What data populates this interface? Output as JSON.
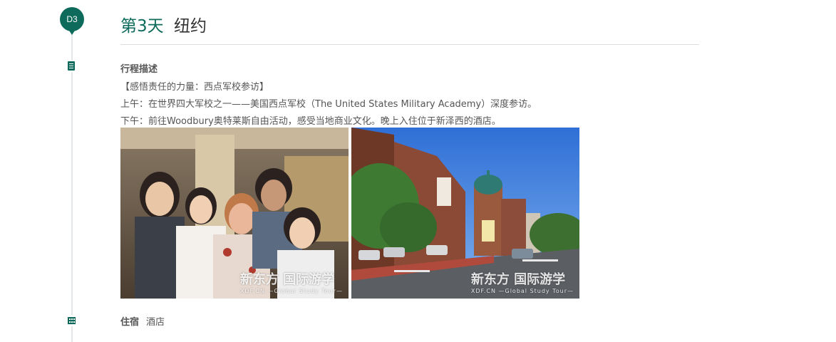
{
  "day": {
    "badge": "D3",
    "label": "第3天",
    "city": "纽约"
  },
  "itinerary": {
    "section_title": "行程描述",
    "lines": [
      "【感悟责任的力量：西点军校参访】",
      "上午：在世界四大军校之一——美国西点军校（The United States Military Academy）深度参访。",
      "下午：前往Woodbury奥特莱斯自由活动，感受当地商业文化。晚上入住位于新泽西的酒店。"
    ]
  },
  "photos": [
    {
      "watermark_main": "新东方 国际游学",
      "watermark_sub": "XDF.CN  —Global Study Tour—"
    },
    {
      "watermark_main": "新东方 国际游学",
      "watermark_sub": "XDF.CN  —Global Study Tour—"
    }
  ],
  "stay": {
    "label": "住宿",
    "value": "酒店"
  },
  "icons": {
    "description": "document-icon",
    "stay": "building-icon"
  },
  "colors": {
    "accent": "#0e6b5c"
  }
}
